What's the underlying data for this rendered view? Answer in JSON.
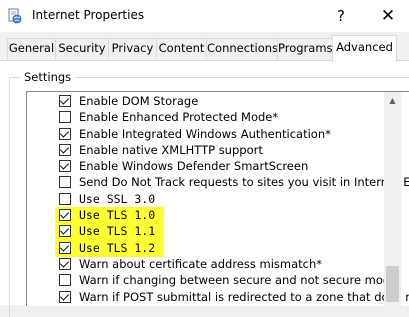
{
  "window": {
    "title": "Internet Properties",
    "help_glyph": "?",
    "close_glyph": "✕"
  },
  "tabs": [
    {
      "label": "General",
      "active": false
    },
    {
      "label": "Security",
      "active": false
    },
    {
      "label": "Privacy",
      "active": false
    },
    {
      "label": "Content",
      "active": false
    },
    {
      "label": "Connections",
      "active": false
    },
    {
      "label": "Programs",
      "active": false
    },
    {
      "label": "Advanced",
      "active": true
    }
  ],
  "settings": {
    "group_label": "Settings",
    "items": [
      {
        "label": "Enable DOM Storage",
        "checked": true,
        "mono": false,
        "highlight": false
      },
      {
        "label": "Enable Enhanced Protected Mode*",
        "checked": false,
        "mono": false,
        "highlight": false
      },
      {
        "label": "Enable Integrated Windows Authentication*",
        "checked": true,
        "mono": false,
        "highlight": false
      },
      {
        "label": "Enable native XMLHTTP support",
        "checked": true,
        "mono": false,
        "highlight": false
      },
      {
        "label": "Enable Windows Defender SmartScreen",
        "checked": true,
        "mono": false,
        "highlight": false
      },
      {
        "label": "Send Do Not Track requests to sites you visit in Internet E",
        "checked": false,
        "mono": false,
        "highlight": false
      },
      {
        "label": "Use SSL 3.0",
        "checked": false,
        "mono": true,
        "highlight": false
      },
      {
        "label": "Use TLS 1.0",
        "checked": true,
        "mono": true,
        "highlight": true
      },
      {
        "label": "Use TLS 1.1",
        "checked": true,
        "mono": true,
        "highlight": true
      },
      {
        "label": "Use TLS 1.2",
        "checked": true,
        "mono": true,
        "highlight": true
      },
      {
        "label": "Warn about certificate address mismatch*",
        "checked": true,
        "mono": false,
        "highlight": false
      },
      {
        "label": "Warn if changing between secure and not secure mode",
        "checked": false,
        "mono": false,
        "highlight": false
      },
      {
        "label": "Warn if POST submittal is redirected to a zone that does n",
        "checked": true,
        "mono": false,
        "highlight": false
      }
    ]
  },
  "colors": {
    "highlight": "#ffff33",
    "panel_bg": "#ffffff",
    "chrome_bg": "#f0f0f0"
  },
  "icons": {
    "app": "internet-properties-icon",
    "scroll_up": "scroll-up-arrow-icon"
  }
}
